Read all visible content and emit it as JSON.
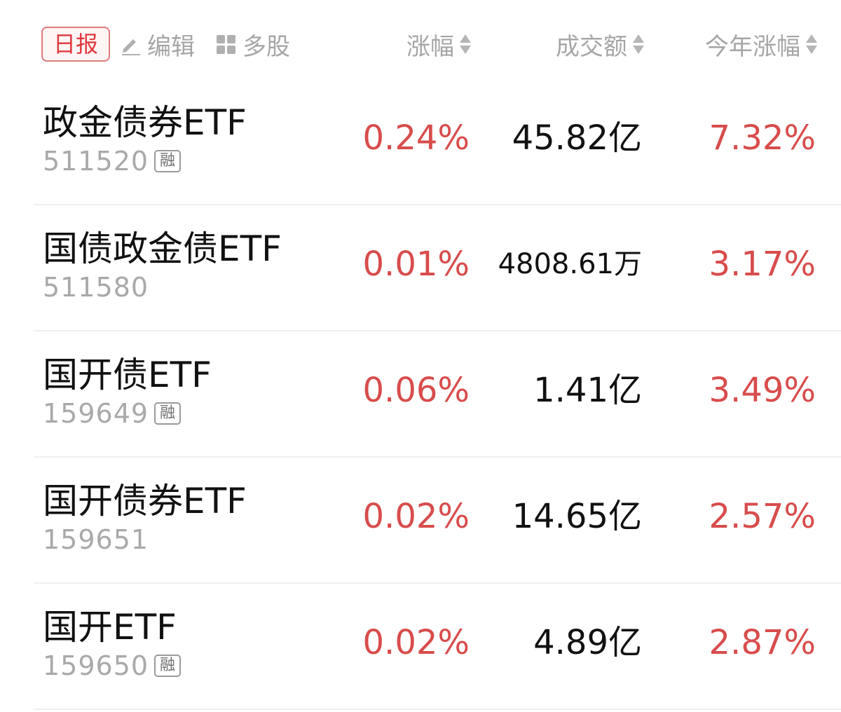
{
  "header": {
    "daily_label": "日报",
    "edit_label": "编辑",
    "multi_label": "多股",
    "columns": {
      "change": "涨幅",
      "volume": "成交额",
      "ytd": "今年涨幅"
    }
  },
  "rows": [
    {
      "name": "政金债券ETF",
      "code": "511520",
      "badge": "融",
      "change": "0.24%",
      "volume": "45.82亿",
      "ytd": "7.32%"
    },
    {
      "name": "国债政金债ETF",
      "code": "511580",
      "badge": "",
      "change": "0.01%",
      "volume": "4808.61万",
      "ytd": "3.17%"
    },
    {
      "name": "国开债ETF",
      "code": "159649",
      "badge": "融",
      "change": "0.06%",
      "volume": "1.41亿",
      "ytd": "3.49%"
    },
    {
      "name": "国开债券ETF",
      "code": "159651",
      "badge": "",
      "change": "0.02%",
      "volume": "14.65亿",
      "ytd": "2.57%"
    },
    {
      "name": "国开ETF",
      "code": "159650",
      "badge": "融",
      "change": "0.02%",
      "volume": "4.89亿",
      "ytd": "2.87%"
    }
  ],
  "colors": {
    "up": "#d84c4c",
    "accent": "#e0393e",
    "muted": "#a6a6a6"
  },
  "icons": {
    "edit": "pencil-icon",
    "multi": "grid-icon",
    "sort": "sort-icon"
  }
}
